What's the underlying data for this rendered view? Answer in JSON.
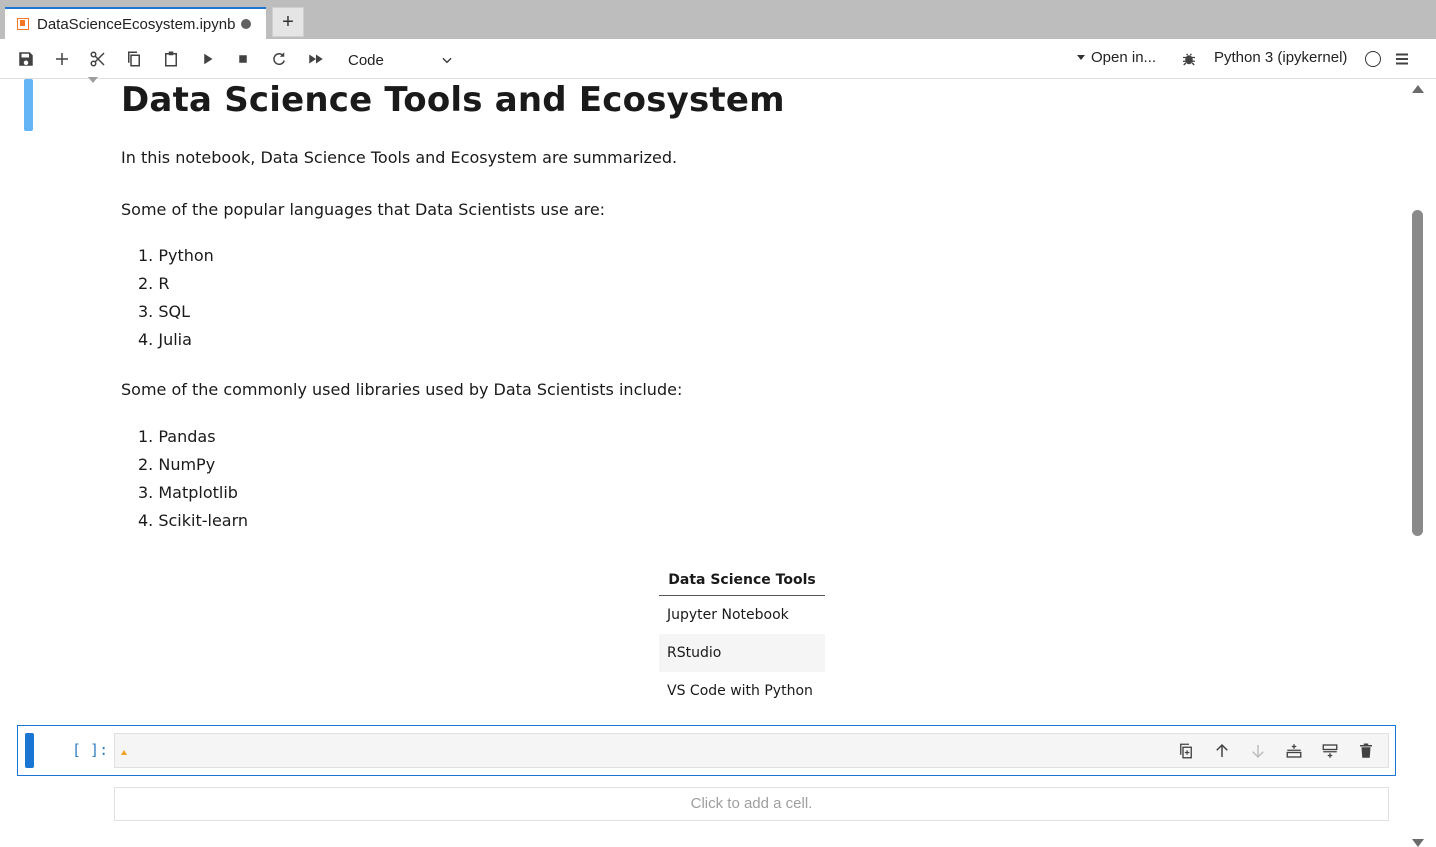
{
  "tab": {
    "title": "DataScienceEcosystem.ipynb",
    "add_label": "+"
  },
  "toolbar": {
    "icons": [
      "save-icon",
      "add-icon",
      "cut-icon",
      "copy-icon",
      "paste-icon",
      "run-icon",
      "stop-icon",
      "restart-icon",
      "fast-forward-icon"
    ],
    "cell_type": "Code",
    "open_in": "Open in...",
    "kernel": "Python 3 (ipykernel)"
  },
  "markdown": {
    "heading": "Data Science Tools and Ecosystem",
    "intro": "In this notebook, Data Science Tools and Ecosystem are summarized.",
    "languages_intro": "Some of the popular languages that Data Scientists use are:",
    "languages": [
      "1. Python",
      "2. R",
      "3. SQL",
      "4. Julia"
    ],
    "libraries_intro": "Some of the commonly used libraries used by Data Scientists include:",
    "libraries": [
      "1. Pandas",
      "2. NumPy",
      "3. Matplotlib",
      "4. Scikit-learn"
    ],
    "table": {
      "header": "Data Science Tools",
      "rows": [
        "Jupyter Notebook",
        "RStudio",
        "VS Code with Python"
      ]
    }
  },
  "code_cell": {
    "prompt": "[ ]:",
    "toolbar_icons": [
      "duplicate-icon",
      "move-up-icon",
      "move-down-icon",
      "insert-above-icon",
      "insert-below-icon",
      "delete-icon"
    ]
  },
  "add_cell_label": "Click to add a cell.",
  "colors": {
    "accent": "#1976d2",
    "active_bar": "#64b5f6",
    "jupyter_orange": "#f37626",
    "prompt_blue": "#307fc1"
  }
}
